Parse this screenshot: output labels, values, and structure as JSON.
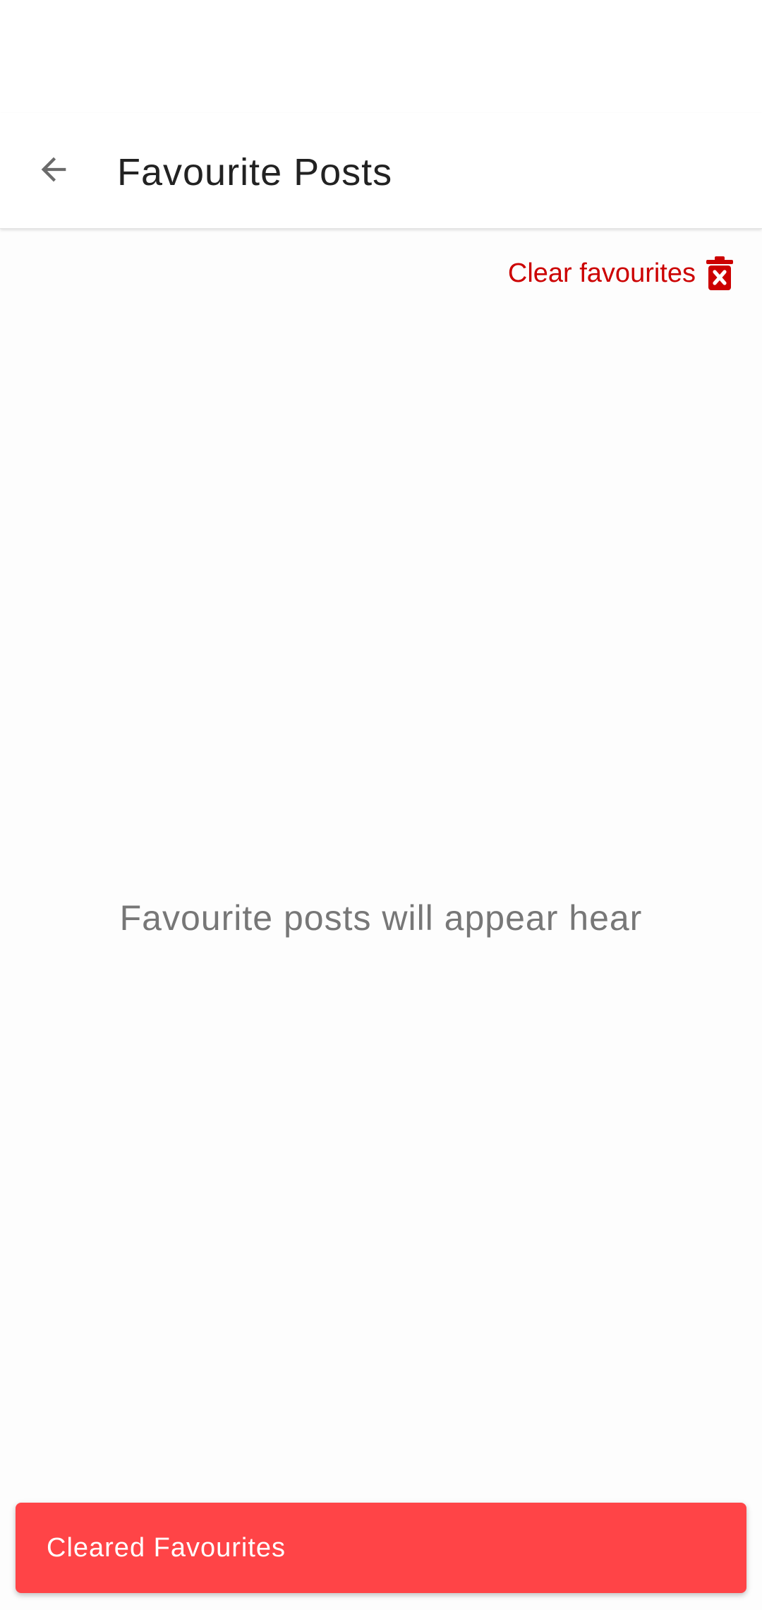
{
  "app_bar": {
    "back_icon": "arrow-back-icon",
    "title": "Favourite Posts"
  },
  "actions": {
    "clear_label": "Clear favourites",
    "clear_icon": "trash-x-icon",
    "accent_color": "#cc0000"
  },
  "empty_state": {
    "message": "Favourite posts will appear hear"
  },
  "snackbar": {
    "text": "Cleared Favourites",
    "background_color": "#ff4447"
  }
}
